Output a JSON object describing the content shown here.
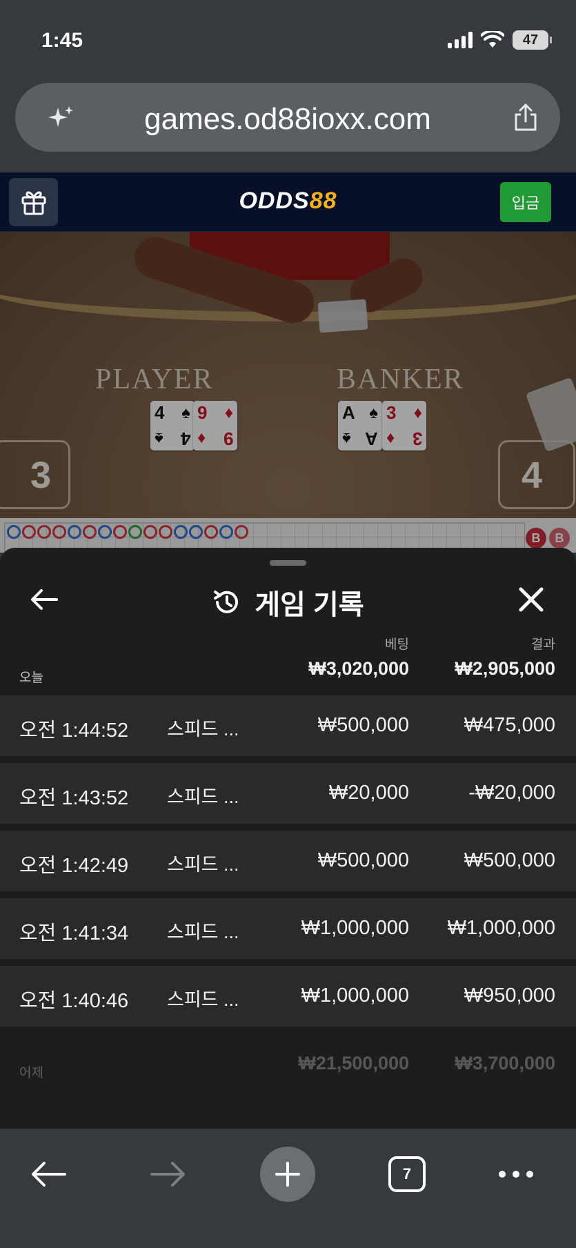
{
  "status_bar": {
    "time": "1:45",
    "battery": "47"
  },
  "browser": {
    "url": "games.od88ioxx.com",
    "tab_count": "7"
  },
  "site": {
    "logo_text": "ODDS",
    "logo_number": "88",
    "deposit_label": "입금"
  },
  "video": {
    "player_label": "PLAYER",
    "banker_label": "BANKER",
    "player_score": "3",
    "banker_score": "4",
    "player_cards": [
      {
        "rank": "4",
        "suit": "♠"
      },
      {
        "rank": "9",
        "suit": "♦"
      }
    ],
    "banker_cards": [
      {
        "rank": "A",
        "suit": "♠"
      },
      {
        "rank": "3",
        "suit": "♦"
      }
    ]
  },
  "roadmap": {
    "badge": "B"
  },
  "history": {
    "title": "게임 기록",
    "bet_header": "베팅",
    "result_header": "결과",
    "today": {
      "label": "오늘",
      "bet_total": "₩3,020,000",
      "result_total": "₩2,905,000"
    },
    "rows": [
      {
        "time": "오전 1:44:52",
        "game": "스피드 ...",
        "bet": "₩500,000",
        "result": "₩475,000"
      },
      {
        "time": "오전 1:43:52",
        "game": "스피드 ...",
        "bet": "₩20,000",
        "result": "-₩20,000"
      },
      {
        "time": "오전 1:42:49",
        "game": "스피드 ...",
        "bet": "₩500,000",
        "result": "₩500,000"
      },
      {
        "time": "오전 1:41:34",
        "game": "스피드 ...",
        "bet": "₩1,000,000",
        "result": "₩1,000,000"
      },
      {
        "time": "오전 1:40:46",
        "game": "스피드 ...",
        "bet": "₩1,000,000",
        "result": "₩950,000"
      }
    ],
    "yesterday": {
      "label": "어제",
      "bet_total": "₩21,500,000",
      "result_total": "₩3,700,000"
    }
  },
  "colors": {
    "deposit_green": "#1f9a34",
    "logo_accent": "#f5b21c",
    "banker_red": "#c72d3b"
  }
}
